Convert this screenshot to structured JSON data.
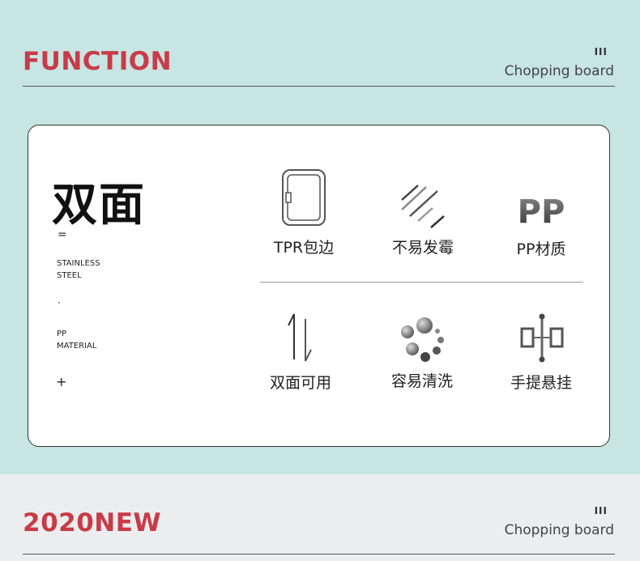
{
  "top_header": {
    "title": "FUNCTION",
    "roman": "III",
    "subtitle": "Chopping board"
  },
  "card": {
    "big_title": "双面",
    "equals": "=",
    "line1a": "STAINLESS",
    "line1b": "STEEL",
    "dot": "·",
    "line2a": "PP",
    "line2b": "MATERIAL",
    "plus": "+"
  },
  "features": [
    {
      "label": "TPR包边",
      "icon": "board-edge-icon"
    },
    {
      "label": "不易发霉",
      "icon": "slash-lines-icon"
    },
    {
      "label": "PP材质",
      "icon": "pp-text-icon",
      "icon_text": "PP"
    },
    {
      "label": "双面可用",
      "icon": "double-arrow-icon"
    },
    {
      "label": "容易清洗",
      "icon": "bubbles-icon"
    },
    {
      "label": "手提悬挂",
      "icon": "hanging-icon"
    }
  ],
  "bottom_header": {
    "title": "2020NEW",
    "roman": "III",
    "subtitle": "Chopping board"
  },
  "colors": {
    "accent_red": "#c83b48",
    "top_bg": "#c7e5e2",
    "bottom_bg": "#ecedee"
  }
}
